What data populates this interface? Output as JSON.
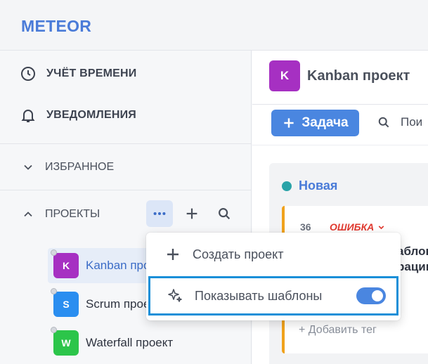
{
  "app": {
    "logo": "METEOR"
  },
  "sidebar": {
    "items": [
      {
        "label": "УЧЁТ ВРЕМЕНИ",
        "icon": "clock-icon"
      },
      {
        "label": "УВЕДОМЛЕНИЯ",
        "icon": "bell-icon"
      }
    ],
    "favorites": {
      "label": "ИЗБРАННОЕ",
      "icon": "chevron-down-icon"
    },
    "projects": {
      "label": "ПРОЕКТЫ",
      "icon": "chevron-up-icon",
      "actions": [
        "more-icon",
        "plus-icon",
        "search-icon"
      ],
      "list": [
        {
          "letter": "K",
          "name": "Kanban проект",
          "color": "#a630c2",
          "selected": true
        },
        {
          "letter": "S",
          "name": "Scrum проект",
          "color": "#2a8ef0",
          "selected": false
        },
        {
          "letter": "W",
          "name": "Waterfall проект",
          "color": "#2cc54a",
          "selected": false
        }
      ]
    }
  },
  "main": {
    "project": {
      "letter": "K",
      "title": "Kanban проект",
      "color": "#a630c2"
    },
    "add_task_label": "Задача",
    "search_label": "Пои",
    "column": {
      "title": "Новая",
      "dot_color": "#2aa3a8",
      "card": {
        "number": "36",
        "tag": "ОШИБКА",
        "title_line1": "аблон",
        "title_line2": "рации",
        "add_tag": "+ Добавить тег"
      }
    }
  },
  "dropdown": {
    "items": [
      {
        "label": "Создать проект",
        "icon": "plus-icon"
      },
      {
        "label": "Показывать шаблоны",
        "icon": "sparkle-icon",
        "toggle_on": true
      }
    ]
  },
  "colors": {
    "accent": "#4a86e0",
    "logo": "#4a7bd8",
    "highlight_border": "#1a8fd8",
    "error": "#e0392f",
    "card_stripe": "#f0a21c"
  }
}
